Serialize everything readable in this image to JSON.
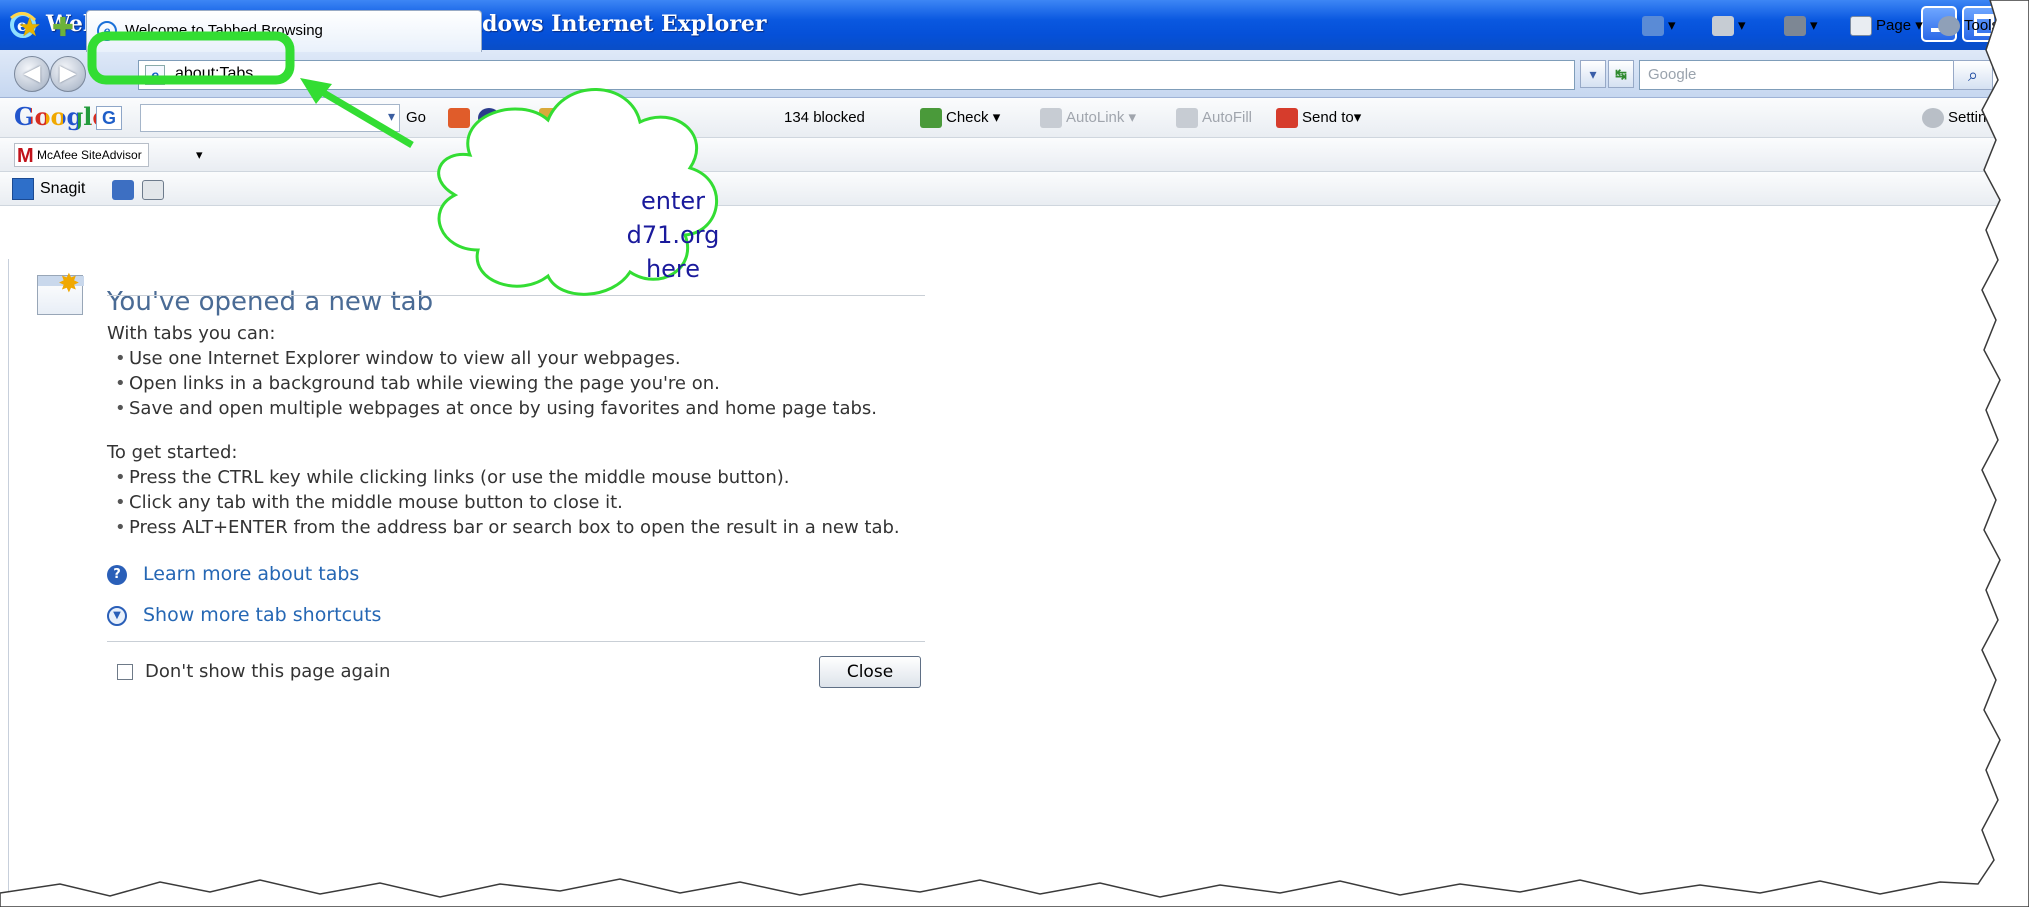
{
  "window": {
    "title": "Welcome to Tabbed Browsing - Windows Internet Explorer"
  },
  "address_bar": {
    "url": "about:Tabs"
  },
  "search": {
    "placeholder": "Google"
  },
  "google_toolbar": {
    "logo": "Google",
    "go_label": "Go",
    "blocked_label": "134 blocked",
    "check_label": "Check",
    "autolink_label": "AutoLink",
    "autofill_label": "AutoFill",
    "sendto_label": "Send to",
    "settings_label": "Settings"
  },
  "mcafee_toolbar": {
    "label": "McAfee SiteAdvisor"
  },
  "snagit_toolbar": {
    "label": "Snagit"
  },
  "tab": {
    "title": "Welcome to Tabbed Browsing"
  },
  "command_bar": {
    "page_label": "Page",
    "tools_label": "Tools"
  },
  "content": {
    "heading": "You've opened a new tab",
    "intro": "With tabs you can:",
    "bullets": [
      "Use one Internet Explorer window to view all your webpages.",
      "Open links in a background tab while viewing the page you're on.",
      "Save and open multiple webpages at once by using favorites and home page tabs."
    ],
    "started": "To get started:",
    "started_bullets": [
      "Press the CTRL key while clicking links (or use the middle mouse button).",
      "Click any tab with the middle mouse button to close it.",
      "Press ALT+ENTER from the address bar or search box to open the result in a new tab."
    ],
    "learn_more": "Learn more about tabs",
    "show_more": "Show more tab shortcuts",
    "dont_show": "Don't show this page again",
    "close_label": "Close"
  },
  "annotation": {
    "lines": [
      "enter",
      "d71.org",
      "here"
    ],
    "color": "#33dd33"
  },
  "colors": {
    "titlebar": "#0a58e0",
    "link": "#2567b4",
    "heading": "#4a6b95"
  }
}
